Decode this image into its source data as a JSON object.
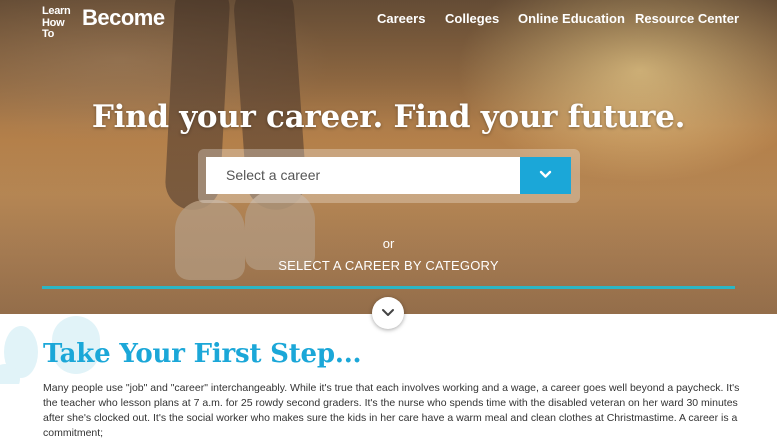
{
  "logo": {
    "line1": "Learn",
    "line2": "How To",
    "word": "Become"
  },
  "nav": {
    "items": [
      {
        "label": "Careers"
      },
      {
        "label": "Colleges"
      },
      {
        "label": "Online Education"
      },
      {
        "label": "Resource Center"
      }
    ]
  },
  "hero": {
    "headline": "Find your career. Find your future.",
    "select": {
      "value": "Select a career",
      "icon": "chevron-down-icon"
    },
    "or_text": "or",
    "category_link": "SELECT A CAREER BY CATEGORY",
    "scroll_icon": "chevron-down-icon"
  },
  "intro": {
    "title": "Take Your First Step...",
    "paragraph": "Many people use \"job\" and \"career\" interchangeably. While it's true that each involves working and a wage, a career goes well beyond a paycheck. It's the teacher who lesson plans at 7 a.m. for 25 rowdy second graders. It's the nurse who spends time with the disabled veteran on her ward 30 minutes after she's clocked out. It's the social worker who makes sure the kids in her care have a warm meal and clean clothes at Christmastime. A career is a commitment;"
  },
  "colors": {
    "accent": "#1ba7d8",
    "bar": "#2bb6c4"
  }
}
